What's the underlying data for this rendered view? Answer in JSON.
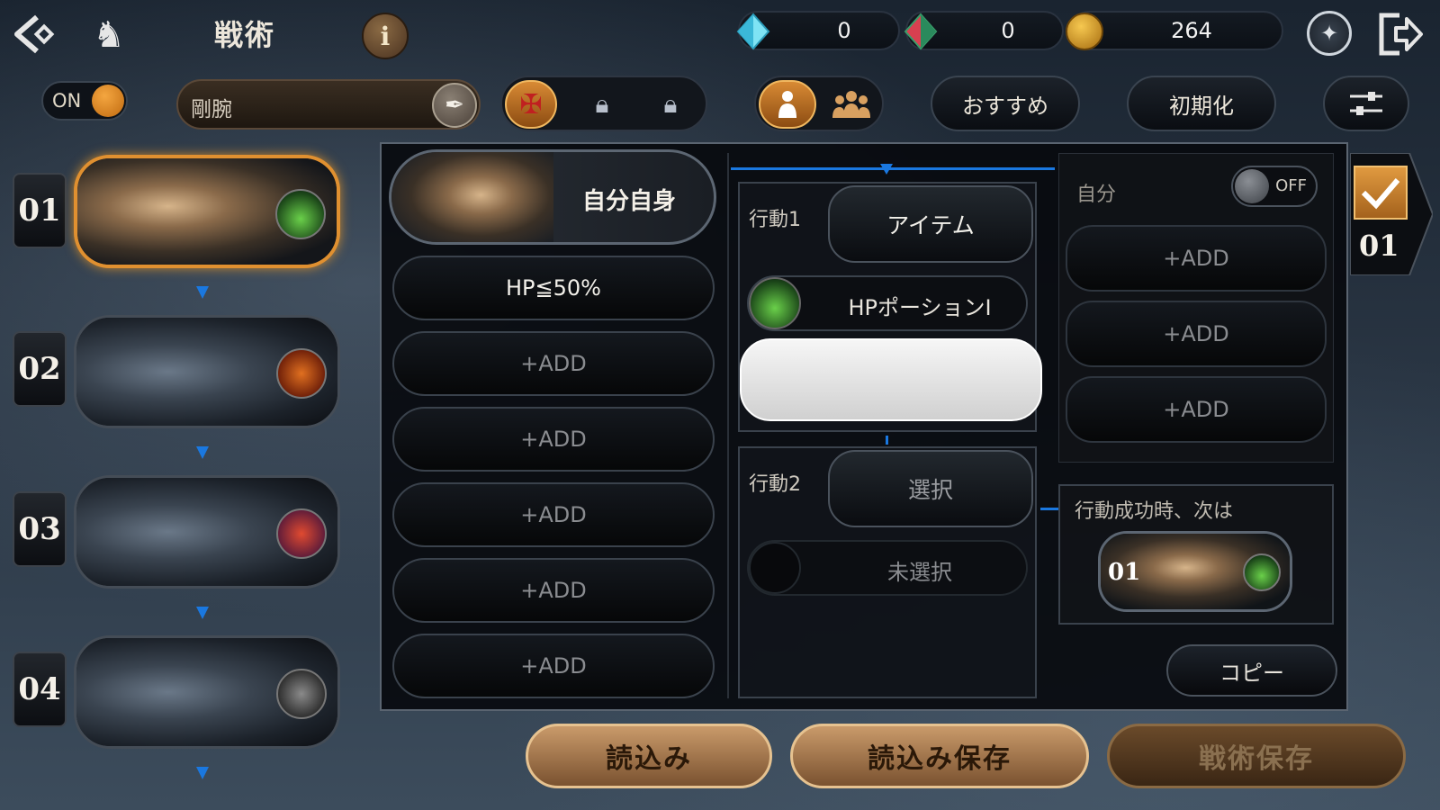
{
  "header": {
    "title": "戦術",
    "info_label": "i",
    "resources": [
      {
        "name": "blue-crystal",
        "value": "0"
      },
      {
        "name": "red-crystal",
        "value": "0"
      },
      {
        "name": "gold-coin",
        "value": "264"
      }
    ]
  },
  "toolbar": {
    "auto_toggle": "ON",
    "tactic_name": "剛腕",
    "recommend": "おすすめ",
    "reset": "初期化"
  },
  "sequence": [
    {
      "number": "01",
      "selected": true
    },
    {
      "number": "02",
      "selected": false
    },
    {
      "number": "03",
      "selected": false
    },
    {
      "number": "04",
      "selected": false
    }
  ],
  "conditions": {
    "target": "自分自身",
    "items": [
      "HP≦50%",
      "+ADD",
      "+ADD",
      "+ADD",
      "+ADD",
      "+ADD"
    ]
  },
  "actions": {
    "action1_label": "行動1",
    "action1_value": "アイテム",
    "item_name": "HPポーションI",
    "action2_label": "行動2",
    "action2_value": "選択",
    "action2_sub": "未選択"
  },
  "self_panel": {
    "label": "自分",
    "toggle": "OFF",
    "add_items": [
      "+ADD",
      "+ADD",
      "+ADD"
    ]
  },
  "next_panel": {
    "label": "行動成功時、次は",
    "target_number": "01"
  },
  "copy_label": "コピー",
  "side_tab_number": "01",
  "footer": {
    "load": "読込み",
    "load_save": "読込み保存",
    "tactic_save": "戦術保存"
  },
  "colors": {
    "accent_orange": "#e09030",
    "connector_blue": "#1a78e0",
    "panel_bg": "#08090c"
  }
}
